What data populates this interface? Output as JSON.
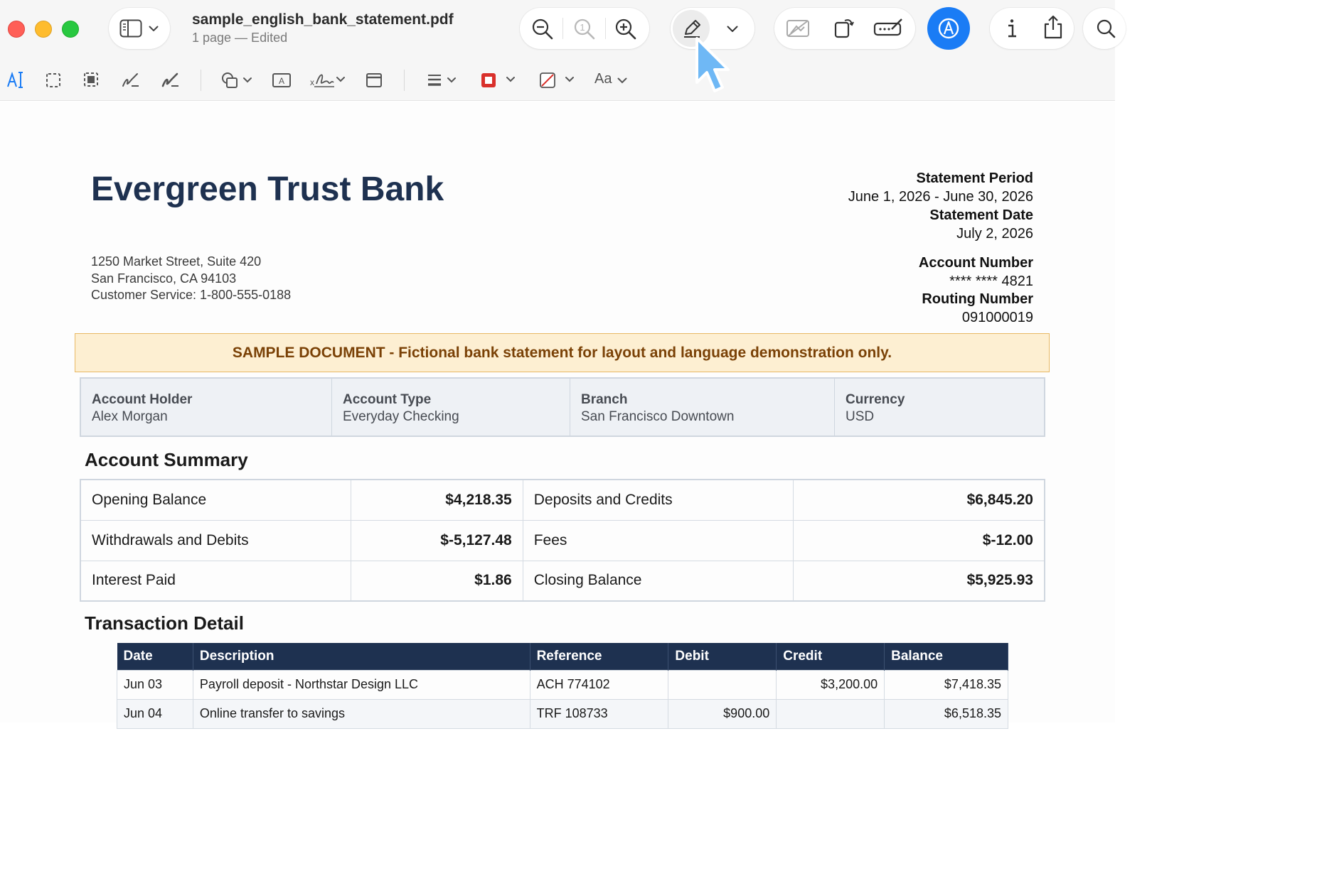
{
  "window": {
    "title": "sample_english_bank_statement.pdf",
    "subtitle": "1 page — Edited"
  },
  "toolbar": {
    "icons": [
      "sidebar-icon",
      "chevron-down-icon",
      "zoom-out-icon",
      "actual-size-icon",
      "zoom-in-icon",
      "pencil-icon",
      "chevron-down-icon",
      "redact-icon",
      "rotate-icon",
      "form-fill-icon",
      "markup-icon",
      "info-icon",
      "share-icon",
      "search-icon"
    ],
    "markup_active_color": "#1a7cf5"
  },
  "markup_toolbar": {
    "icons": [
      "text-selection-icon",
      "rectangular-selection-icon",
      "smart-selection-icon",
      "sketch-icon",
      "draw-icon",
      "shapes-icon",
      "text-box-icon",
      "sign-icon",
      "note-icon",
      "line-style-icon",
      "border-color-icon",
      "fill-color-icon"
    ],
    "font_label": "Aa",
    "border_color": "#d9302b"
  },
  "document": {
    "bank_name": "Evergreen Trust Bank",
    "address_line1": "1250 Market Street, Suite 420",
    "address_line2": "San Francisco, CA 94103",
    "address_line3": "Customer Service: 1-800-555-0188",
    "statement_period_label": "Statement Period",
    "statement_period": "June 1, 2026 - June 30, 2026",
    "statement_date_label": "Statement Date",
    "statement_date": "July 2, 2026",
    "account_number_label": "Account Number",
    "account_number": "**** **** 4821",
    "routing_number_label": "Routing Number",
    "routing_number": "091000019",
    "banner": "SAMPLE DOCUMENT - Fictional bank statement for layout and language demonstration only.",
    "info": [
      {
        "label": "Account Holder",
        "value": "Alex Morgan"
      },
      {
        "label": "Account Type",
        "value": "Everyday Checking"
      },
      {
        "label": "Branch",
        "value": "San Francisco Downtown"
      },
      {
        "label": "Currency",
        "value": "USD"
      }
    ],
    "summary_title": "Account Summary",
    "summary": [
      {
        "label1": "Opening Balance",
        "value1": "$4,218.35",
        "label2": "Deposits and Credits",
        "value2": "$6,845.20"
      },
      {
        "label1": "Withdrawals and Debits",
        "value1": "$-5,127.48",
        "label2": "Fees",
        "value2": "$-12.00"
      },
      {
        "label1": "Interest Paid",
        "value1": "$1.86",
        "label2": "Closing Balance",
        "value2": "$5,925.93"
      }
    ],
    "transactions_title": "Transaction Detail",
    "tx_headers": [
      "Date",
      "Description",
      "Reference",
      "Debit",
      "Credit",
      "Balance"
    ],
    "transactions": [
      {
        "date": "Jun 03",
        "description": "Payroll deposit - Northstar Design LLC",
        "reference": "ACH 774102",
        "debit": "",
        "credit": "$3,200.00",
        "balance": "$7,418.35"
      },
      {
        "date": "Jun 04",
        "description": "Online transfer to savings",
        "reference": "TRF 108733",
        "debit": "$900.00",
        "credit": "",
        "balance": "$6,518.35"
      }
    ]
  }
}
